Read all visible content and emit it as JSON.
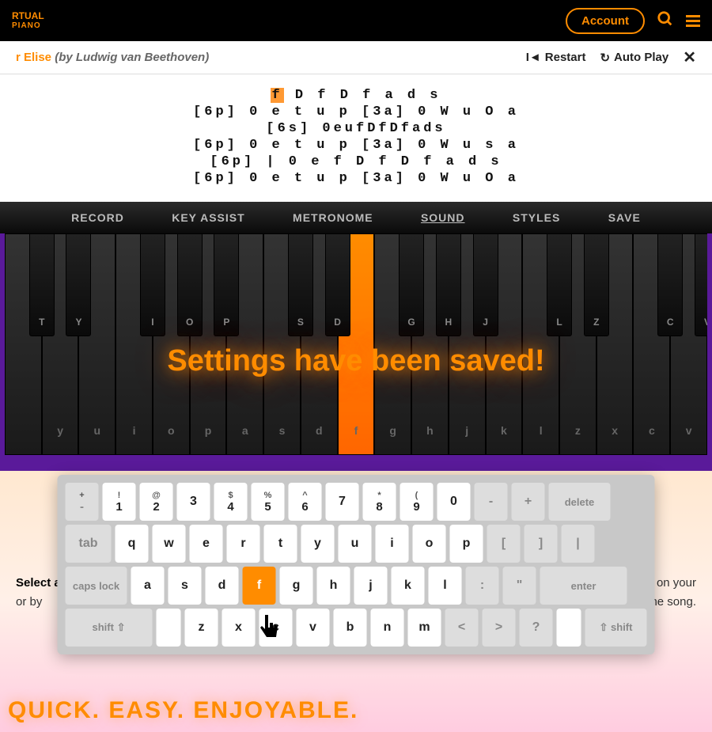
{
  "header": {
    "logo_top": "RTUAL",
    "logo_bot": "PIANO",
    "account": "Account"
  },
  "title": {
    "song": "r Elise",
    "artist": "(by Ludwig van Beethoven)",
    "restart": "Restart",
    "autoplay": "Auto Play"
  },
  "sheet": [
    "f D f D f a d s",
    "[6p] 0 e t u p [3a] 0 W u O a",
    "[6s] 0eufDfDfads",
    "[6p] 0 e t u p [3a] 0 W u s a",
    "[6p] | 0 e f D f D f a d s",
    "[6p] 0 e t u p [3a] 0 W u O a"
  ],
  "toolbar": [
    "RECORD",
    "KEY ASSIST",
    "METRONOME",
    "SOUND",
    "STYLES",
    "SAVE"
  ],
  "toolbar_active": 3,
  "toast": "Settings have been saved!",
  "white_keys": [
    "",
    "y",
    "u",
    "i",
    "o",
    "p",
    "a",
    "s",
    "d",
    "f",
    "g",
    "h",
    "j",
    "k",
    "l",
    "z",
    "x",
    "c",
    "v"
  ],
  "highlight_white": 9,
  "black_keys": {
    "labels": [
      "T",
      "Y",
      "",
      "I",
      "O",
      "P",
      "",
      "S",
      "D",
      "",
      "G",
      "H",
      "J",
      "",
      "L",
      "Z",
      "",
      "C",
      "V"
    ],
    "skip": [
      2,
      6,
      9,
      13,
      16
    ]
  },
  "keyboard": {
    "row1": [
      {
        "t": "+",
        "b": "-",
        "g": 1
      },
      {
        "t": "!",
        "b": "1"
      },
      {
        "t": "@",
        "b": "2"
      },
      {
        "t": "",
        "b": "3"
      },
      {
        "t": "$",
        "b": "4"
      },
      {
        "t": "%",
        "b": "5"
      },
      {
        "t": "^",
        "b": "6"
      },
      {
        "t": "",
        "b": "7"
      },
      {
        "t": "*",
        "b": "8"
      },
      {
        "t": "(",
        "b": "9"
      },
      {
        "t": "",
        "b": "0"
      },
      {
        "t": "",
        "b": "-",
        "g": 1
      },
      {
        "t": "",
        "b": "+",
        "g": 1
      },
      {
        "t": "",
        "b": "delete",
        "g": 1,
        "w": "wider"
      }
    ],
    "row2": [
      {
        "b": "tab",
        "g": 1,
        "w": "wide"
      },
      {
        "b": "q"
      },
      {
        "b": "w"
      },
      {
        "b": "e"
      },
      {
        "b": "r"
      },
      {
        "b": "t"
      },
      {
        "b": "y"
      },
      {
        "b": "u"
      },
      {
        "b": "i"
      },
      {
        "b": "o"
      },
      {
        "b": "p"
      },
      {
        "b": "[",
        "g": 1
      },
      {
        "b": "]",
        "g": 1
      },
      {
        "b": "|",
        "g": 1
      }
    ],
    "row3": [
      {
        "b": "caps lock",
        "g": 1,
        "w": "wider"
      },
      {
        "b": "a"
      },
      {
        "b": "s"
      },
      {
        "b": "d"
      },
      {
        "b": "f",
        "hl": 1
      },
      {
        "b": "g"
      },
      {
        "b": "h"
      },
      {
        "b": "j"
      },
      {
        "b": "k"
      },
      {
        "b": "l"
      },
      {
        "b": ":",
        "g": 1
      },
      {
        "b": "\"",
        "g": 1
      },
      {
        "b": "enter",
        "g": 1,
        "w": "entershift"
      }
    ],
    "row4": [
      {
        "b": "shift ⇧",
        "g": 1,
        "w": "entershift"
      },
      {
        "b": "",
        "sp": 1
      },
      {
        "b": "z"
      },
      {
        "b": "x"
      },
      {
        "b": "c"
      },
      {
        "b": "v"
      },
      {
        "b": "b"
      },
      {
        "b": "n"
      },
      {
        "b": "m"
      },
      {
        "b": "<",
        "g": 1
      },
      {
        "b": ">",
        "g": 1
      },
      {
        "b": "?",
        "g": 1
      },
      {
        "b": "",
        "sp": 1
      },
      {
        "b": "⇧ shift",
        "g": 1,
        "w": "wider"
      }
    ]
  },
  "behind": {
    "left": "Select a s",
    "right_top": "on your",
    "right_bot": "or by",
    "right_end": "he song."
  },
  "tagline": "QUICK. EASY. ENJOYABLE."
}
